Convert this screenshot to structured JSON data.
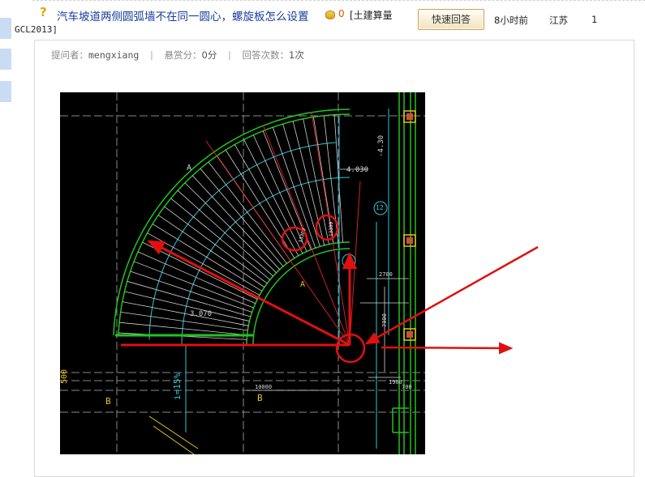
{
  "question": {
    "title": "汽车坡道两侧圆弧墙不在同一圆心，螺旋板怎么设置",
    "points": "0",
    "category_line1": "[土建算量",
    "category_line2": "GCL2013]"
  },
  "actions": {
    "quick_answer_label": "快速回答"
  },
  "row": {
    "time": "8小时前",
    "region": "江苏",
    "answer_count": "1"
  },
  "meta": {
    "asker_label": "提问者：",
    "asker_name": "mengxiang",
    "reward_label": "悬赏分：",
    "reward_value": "0分",
    "answers_label": "回答次数：",
    "answers_value": "1次",
    "separator": "|"
  },
  "drawing": {
    "labels": {
      "elev_top": "4.030",
      "elev_right": "-4.30",
      "elev_bottom": "3.070",
      "dim_2700": "2700",
      "dim_7000": "7000",
      "dim_1900": "1900",
      "dim_700": "700",
      "dim_10000": "10000",
      "dim_13300": "13300",
      "dim_13300b": "13300",
      "slope": "i=15%",
      "axis_b": "B",
      "axis_a": "A",
      "axis_500": "500",
      "axis_12": "12"
    },
    "colors": {
      "background": "#000000",
      "green": "#22c21f",
      "cyan": "#2fc6d8",
      "white": "#d8d8d8",
      "red_line": "#d0202a",
      "annotation_red": "#e01010",
      "yellow": "#e6c619"
    }
  }
}
